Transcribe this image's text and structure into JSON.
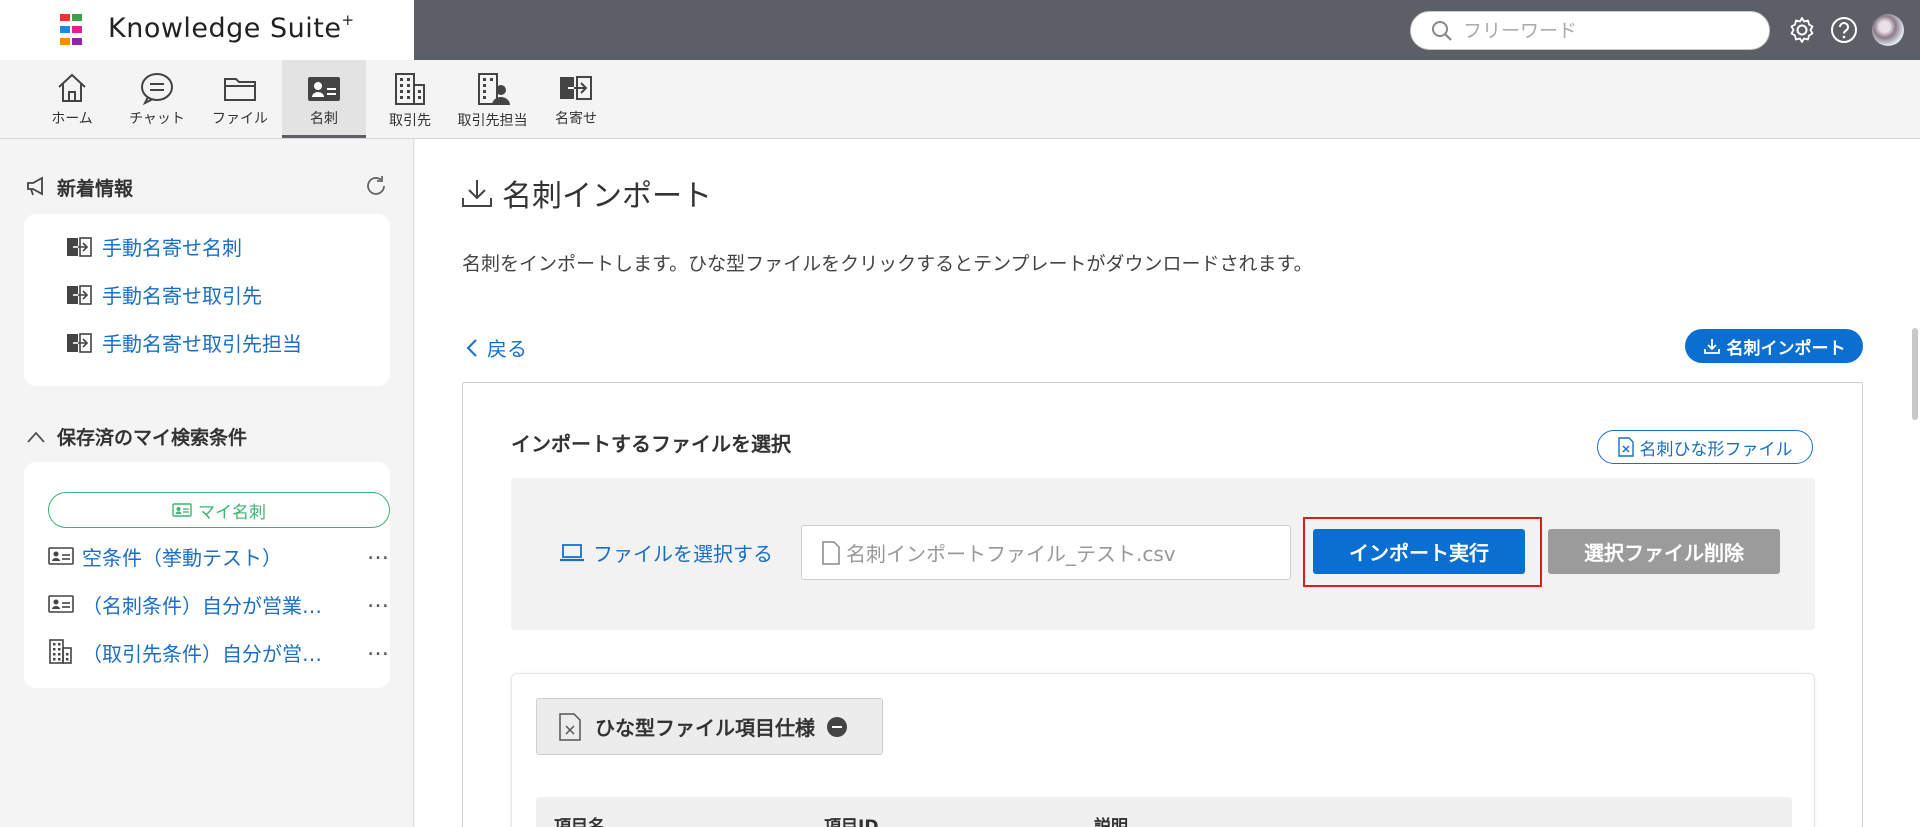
{
  "app": {
    "name": "Knowledge Suite",
    "name_suffix": "+",
    "logo_colors": [
      "#e53935",
      "#e91e8c",
      "#43a047",
      "#1e88e5",
      "#fb8c00",
      "#8e24aa"
    ]
  },
  "header": {
    "search_placeholder": "フリーワード",
    "icons": [
      "search-icon",
      "gear-icon",
      "help-icon",
      "avatar"
    ]
  },
  "nav": {
    "items": [
      {
        "label": "ホーム",
        "icon": "home-icon"
      },
      {
        "label": "チャット",
        "icon": "chat-icon"
      },
      {
        "label": "ファイル",
        "icon": "folder-icon"
      },
      {
        "label": "名刺",
        "icon": "business-card-icon",
        "active": true
      },
      {
        "label": "取引先",
        "icon": "building-icon"
      },
      {
        "label": "取引先担当",
        "icon": "building-person-icon"
      },
      {
        "label": "名寄せ",
        "icon": "merge-icon"
      }
    ]
  },
  "sidebar": {
    "news_title": "新着情報",
    "news_items": [
      "手動名寄せ名刺",
      "手動名寄せ取引先",
      "手動名寄せ取引先担当"
    ],
    "saved_title": "保存済のマイ検索条件",
    "my_card_button": "マイ名刺",
    "conditions": [
      {
        "label": "空条件（挙動テスト）",
        "icon": "business-card-icon"
      },
      {
        "label": "（名刺条件）自分が営業担当",
        "icon": "business-card-icon"
      },
      {
        "label": "（取引先条件）自分が営業担当",
        "icon": "building-icon"
      }
    ],
    "more_label": "…"
  },
  "main": {
    "title": "名刺インポート",
    "description": "名刺をインポートします。ひな型ファイルをクリックするとテンプレートがダウンロードされます。",
    "back_label": "戻る",
    "import_pill_label": "名刺インポート",
    "section_title": "インポートするファイルを選択",
    "template_file_label": "名刺ひな形ファイル",
    "choose_file_label": "ファイルを選択する",
    "selected_file": "名刺インポートファイル_テスト.csv",
    "execute_button": "インポート実行",
    "delete_button": "選択ファイル削除",
    "spec_button": "ひな型ファイル項目仕様",
    "spec_columns": [
      "項目名",
      "項目ID",
      "説明"
    ]
  },
  "colors": {
    "accent": "#0b6fd1",
    "link": "#1a6fc4",
    "highlight": "#e11b1b",
    "header_bg": "#5c5f66",
    "my_card": "#3cb371"
  }
}
